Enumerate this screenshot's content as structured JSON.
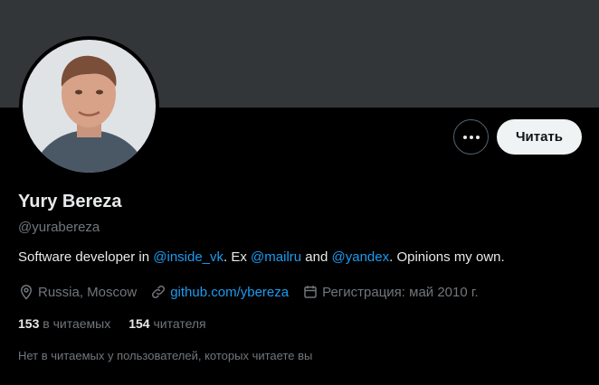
{
  "profile": {
    "name": "Yury Bereza",
    "handle": "@yurabereza",
    "bio": {
      "prefix": "Software developer in ",
      "mention_1": "@inside_vk",
      "mid_1": ". Ex ",
      "mention_2": "@mailru",
      "mid_2": " and ",
      "mention_3": "@yandex",
      "suffix": ". Opinions my own."
    },
    "location": "Russia, Moscow",
    "website": "github.com/ybereza",
    "joined": "Регистрация: май 2010 г."
  },
  "actions": {
    "more_icon": "more-dots-icon",
    "follow_label": "Читать"
  },
  "stats": {
    "following_count": "153",
    "following_label": "в читаемых",
    "followers_count": "154",
    "followers_label": "читателя"
  },
  "followers_note": "Нет в читаемых у пользователей, которых читаете вы",
  "icons": {
    "location": "location-pin-icon",
    "website": "link-icon",
    "joined": "calendar-icon"
  },
  "colors": {
    "background": "#000000",
    "banner": "#333639",
    "accent": "#1d9bf0",
    "muted_text": "#71767b",
    "primary_text": "#e7e9ea",
    "follow_button_bg": "#eff3f4"
  }
}
